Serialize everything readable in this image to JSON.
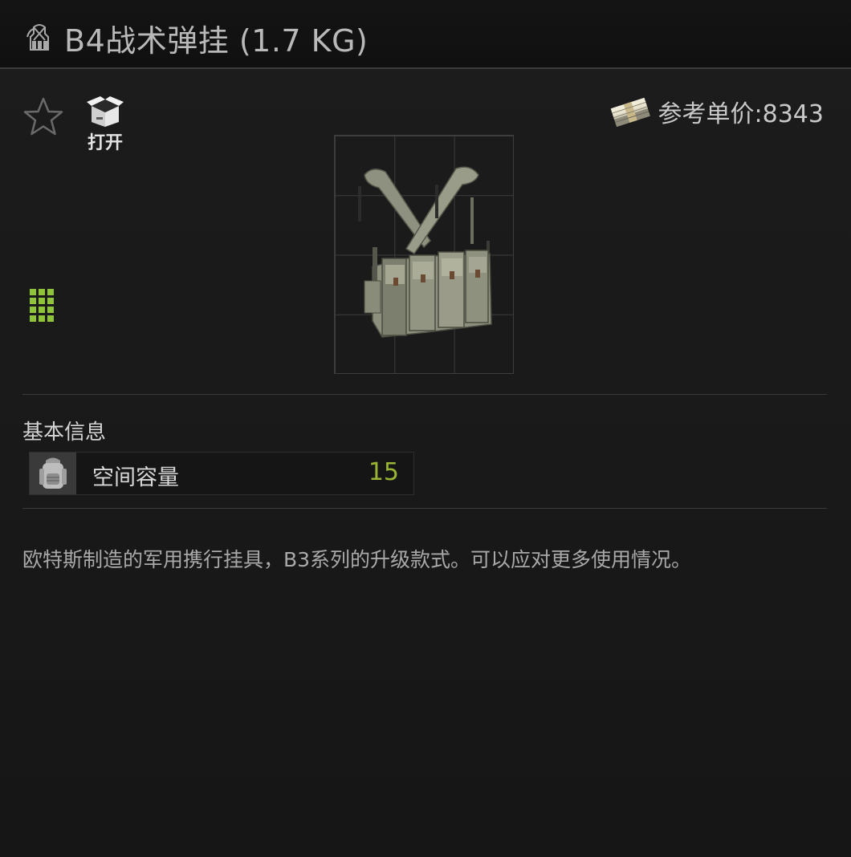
{
  "header": {
    "title": "B4战术弹挂 (1.7 KG)",
    "title_icon": "rig-icon"
  },
  "toolbar": {
    "favorite_icon": "star-icon",
    "open_label": "打开",
    "open_icon": "open-box-icon"
  },
  "price": {
    "label": "参考单价:8343",
    "icon": "money-stack-icon"
  },
  "item": {
    "grid_columns": 3,
    "grid_rows": 4,
    "image": "chest-rig-image"
  },
  "info": {
    "section_title": "基本信息",
    "stats": [
      {
        "icon": "backpack-icon",
        "label": "空间容量",
        "value": "15"
      }
    ]
  },
  "description": "欧特斯制造的军用携行挂具，B3系列的升级款式。可以应对更多使用情况。",
  "colors": {
    "accent_green": "#9ab534",
    "grid_indicator": "#8fc43a"
  }
}
